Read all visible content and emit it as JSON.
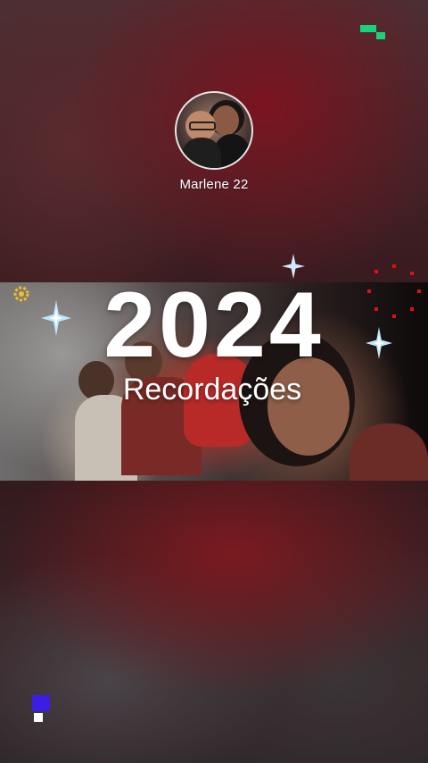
{
  "profile": {
    "name": "Marlene 22",
    "avatar_icon": "profile-photo"
  },
  "banner": {
    "year": "2024",
    "subtitle": "Recordações"
  },
  "decorations": {
    "glitch_top_color": "#17d37a",
    "glitch_bottom_colors": [
      "#3b1ee6",
      "#ffffff"
    ],
    "sparkle_color": "#bfe6ff",
    "sun_color": "#f0c020",
    "dots_color": "#e01010",
    "icons": [
      "glitch-icon",
      "sparkle-icon",
      "sun-icon",
      "dots-icon"
    ]
  }
}
